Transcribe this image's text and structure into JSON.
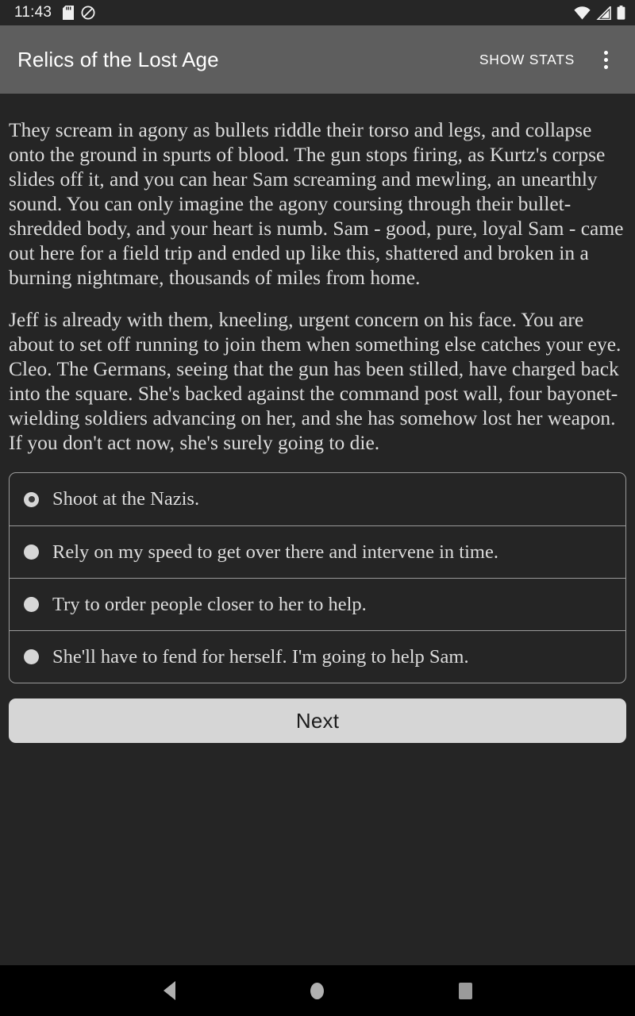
{
  "status_bar": {
    "clock": "11:43",
    "left_icons": [
      "sd-card-icon",
      "do-not-disturb-icon"
    ],
    "right_icons": [
      "wifi-icon",
      "cell-signal-icon",
      "battery-icon"
    ]
  },
  "app_bar": {
    "title": "Relics of the Lost Age",
    "show_stats_label": "SHOW STATS",
    "overflow_icon": "more-vert-icon",
    "background_color": "#5e5e5e"
  },
  "story": {
    "paragraphs": [
      "They scream in agony as bullets riddle their torso and legs, and collapse onto the ground in spurts of blood. The gun stops firing, as Kurtz's corpse slides off it, and you can hear Sam screaming and mewling, an unearthly sound. You can only imagine the agony coursing through their bullet-shredded body, and your heart is numb. Sam - good, pure, loyal Sam - came out here for a field trip and ended up like this, shattered and broken in a burning nightmare, thousands of miles from home.",
      "Jeff is already with them, kneeling, urgent concern on his face. You are about to set off running to join them when something else catches your eye. Cleo. The Germans, seeing that the gun has been stilled, have charged back into the square. She's backed against the command post wall, four bayonet-wielding soldiers advancing on her, and she has somehow lost her weapon. If you don't act now, she's surely going to die."
    ]
  },
  "choices": {
    "selected_index": 0,
    "options": [
      {
        "label": "Shoot at the Nazis.",
        "selected": true
      },
      {
        "label": "Rely on my speed to get over there and intervene in time.",
        "selected": false
      },
      {
        "label": "Try to order people closer to her to help.",
        "selected": false
      },
      {
        "label": "She'll have to fend for herself. I'm going to help Sam.",
        "selected": false
      }
    ]
  },
  "next_button": {
    "label": "Next"
  },
  "nav_bar": {
    "back_icon": "back-triangle-icon",
    "home_icon": "home-circle-icon",
    "recents_icon": "recents-square-icon"
  },
  "colors": {
    "page_background": "#252525",
    "app_bar": "#5e5e5e",
    "text": "#dcdcdc",
    "accent_light": "#d6d6d6"
  }
}
